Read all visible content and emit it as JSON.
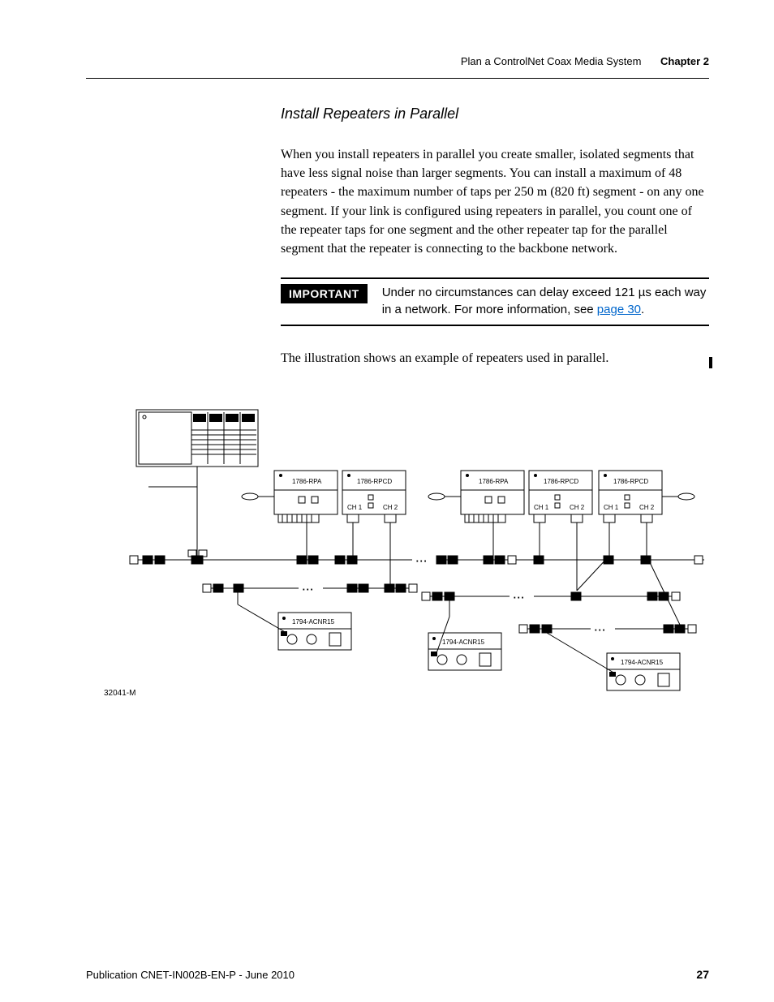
{
  "header": {
    "breadcrumb": "Plan a ControlNet Coax Media System",
    "chapter": "Chapter 2"
  },
  "section": {
    "title": "Install Repeaters in Parallel",
    "body": "When you install repeaters in parallel you create smaller, isolated segments that have less signal noise than larger segments. You can install a maximum of 48 repeaters - the maximum number of taps per 250 m (820 ft) segment - on any one segment. If your link is configured using repeaters in parallel, you count one of the repeater taps for one segment and the other repeater tap for the parallel segment that the repeater is connecting to the backbone network.",
    "lead_out": "The illustration shows an example of repeaters used in parallel."
  },
  "important": {
    "label": "IMPORTANT",
    "text_prefix": "Under no circumstances can delay exceed 121 µs each way in a network. For more information, see ",
    "link_text": "page 30",
    "text_suffix": "."
  },
  "diagram": {
    "ref": "32041-M",
    "modules": {
      "rpa1": "1786-RPA",
      "rpcd1": "1786-RPCD",
      "rpa2": "1786-RPA",
      "rpcd2": "1786-RPCD",
      "rpcd3": "1786-RPCD",
      "acnr1": "1794-ACNR15",
      "acnr2": "1794-ACNR15",
      "acnr3": "1794-ACNR15",
      "ch1": "CH 1",
      "ch2": "CH 2"
    }
  },
  "footer": {
    "pub": "Publication CNET-IN002B-EN-P - June 2010",
    "page": "27"
  }
}
